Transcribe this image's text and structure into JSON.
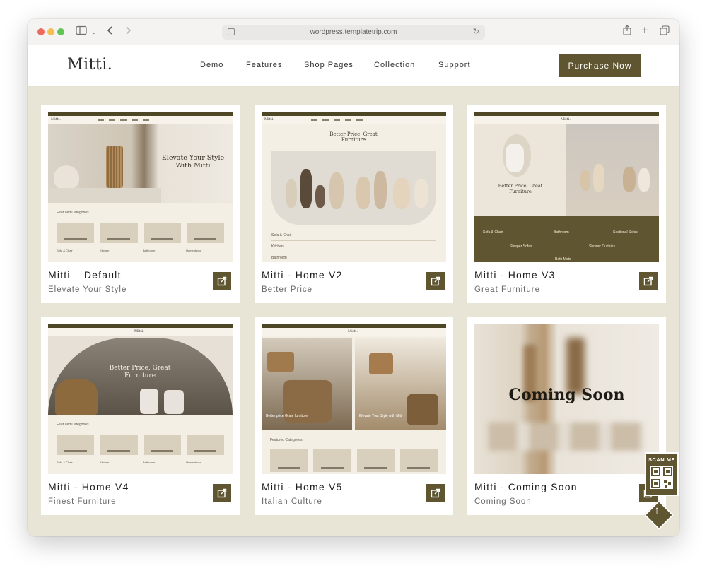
{
  "browser": {
    "url": "wordpress.templatetrip.com"
  },
  "site": {
    "logo": "Mitti.",
    "nav": [
      "Demo",
      "Features",
      "Shop Pages",
      "Collection",
      "Support"
    ],
    "purchase_label": "Purchase Now"
  },
  "cards": [
    {
      "title": "Mitti – Default",
      "subtitle": "Elevate Your Style",
      "hero": "Elevate Your Style With Mitti"
    },
    {
      "title": "Mitti - Home V2",
      "subtitle": "Better Price",
      "hero": "Better Price, Great Furniture"
    },
    {
      "title": "Mitti - Home V3",
      "subtitle": "Great Furniture",
      "hero": "Better Price, Great Furniture"
    },
    {
      "title": "Mitti - Home V4",
      "subtitle": "Finest Furniture",
      "hero": "Better Price, Great Furniture"
    },
    {
      "title": "Mitti - Home V5",
      "subtitle": "Italian Culture",
      "hero": "Better price Grate furniture"
    },
    {
      "title": "Mitti - Coming Soon",
      "subtitle": "Coming Soon",
      "hero": "Coming Soon"
    }
  ],
  "thumb_text": {
    "featured": "Featured Categories",
    "cats": [
      "Sofa & Chair",
      "Kitchen",
      "Bathroom",
      "Home decor"
    ],
    "v2_list": [
      "Sofa & Chair",
      "Kitchen",
      "Bathroom"
    ],
    "v3_cats": [
      "Sofa & Chair",
      "Bathroom",
      "Sectional Sofas",
      "Sleeper Sofas",
      "Shower Curtains",
      "Bath Mats"
    ],
    "v5_hero2": "Elevate Your Style with Mitti"
  },
  "widgets": {
    "scan_label": "SCAN ME"
  },
  "colors": {
    "brand": "#5f5530",
    "background": "#e8e4d6"
  }
}
